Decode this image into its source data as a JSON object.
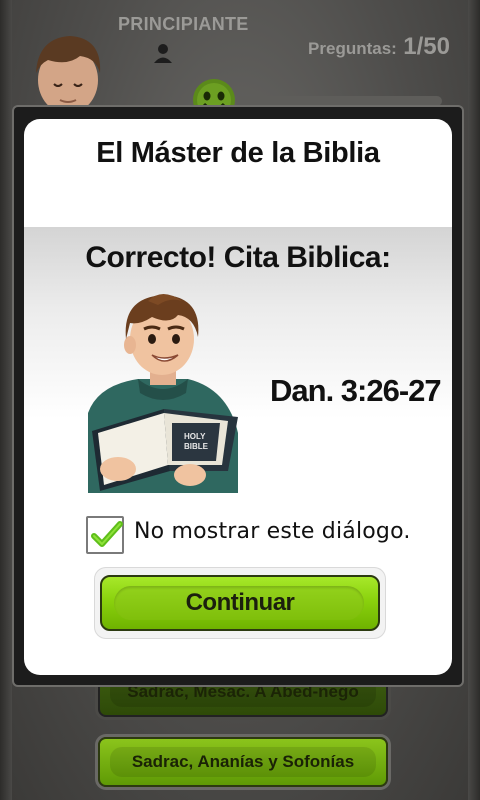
{
  "background": {
    "level_label": "PRINCIPIANTE",
    "questions_label": "Preguntas:",
    "questions_value": "1/50",
    "answers": [
      {
        "label": "Sadrac, Mesac. A Abed-nego"
      },
      {
        "label": "Sadrac, Ananías y Sofonías"
      }
    ],
    "icons": {
      "avatar": "boy-avatar",
      "user": "user-icon",
      "mood": "smiley-icon"
    }
  },
  "dialog": {
    "title": "El Máster de la Biblia",
    "heading": "Correcto! Cita Biblica:",
    "citation": "Dan. 3:26-27",
    "checkbox_label": "No mostrar este diálogo.",
    "checkbox_checked": true,
    "continue_label": "Continuar",
    "illustration": "boy-reading-bible"
  },
  "colors": {
    "accent_green": "#8ad10d",
    "check_green": "#5fbf1a",
    "dim_background": "#4f4e4c"
  }
}
